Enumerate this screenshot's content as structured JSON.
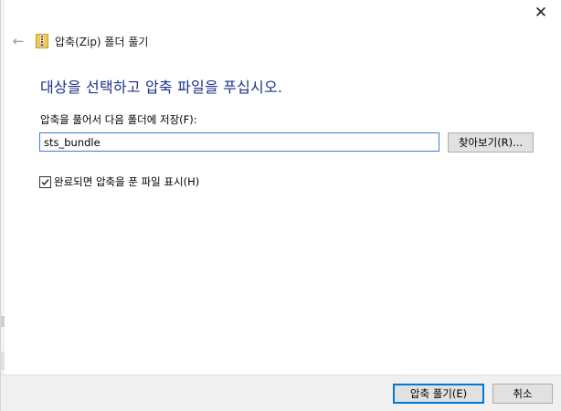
{
  "window": {
    "close_glyph": "✕",
    "title": "압축(Zip) 폴더 풀기",
    "back_glyph": "←",
    "icon": "zip-folder-icon"
  },
  "main": {
    "instruction": "대상을 선택하고 압축 파일을 푸십시오.",
    "destination_label": "압축을 풀어서 다음 폴더에 저장(F):",
    "destination_value": "sts_bundle",
    "browse_label": "찾아보기(R)...",
    "show_files_label": "완료되면 압축을 푼 파일 표시(H)",
    "show_files_checked": true
  },
  "footer": {
    "extract_label": "압축 풀기(E)",
    "cancel_label": "취소"
  },
  "colors": {
    "instruction_text": "#1e3287",
    "focus_border": "#0078d7",
    "button_bg": "#e1e1e1",
    "footer_bg": "#f0f0f0"
  }
}
